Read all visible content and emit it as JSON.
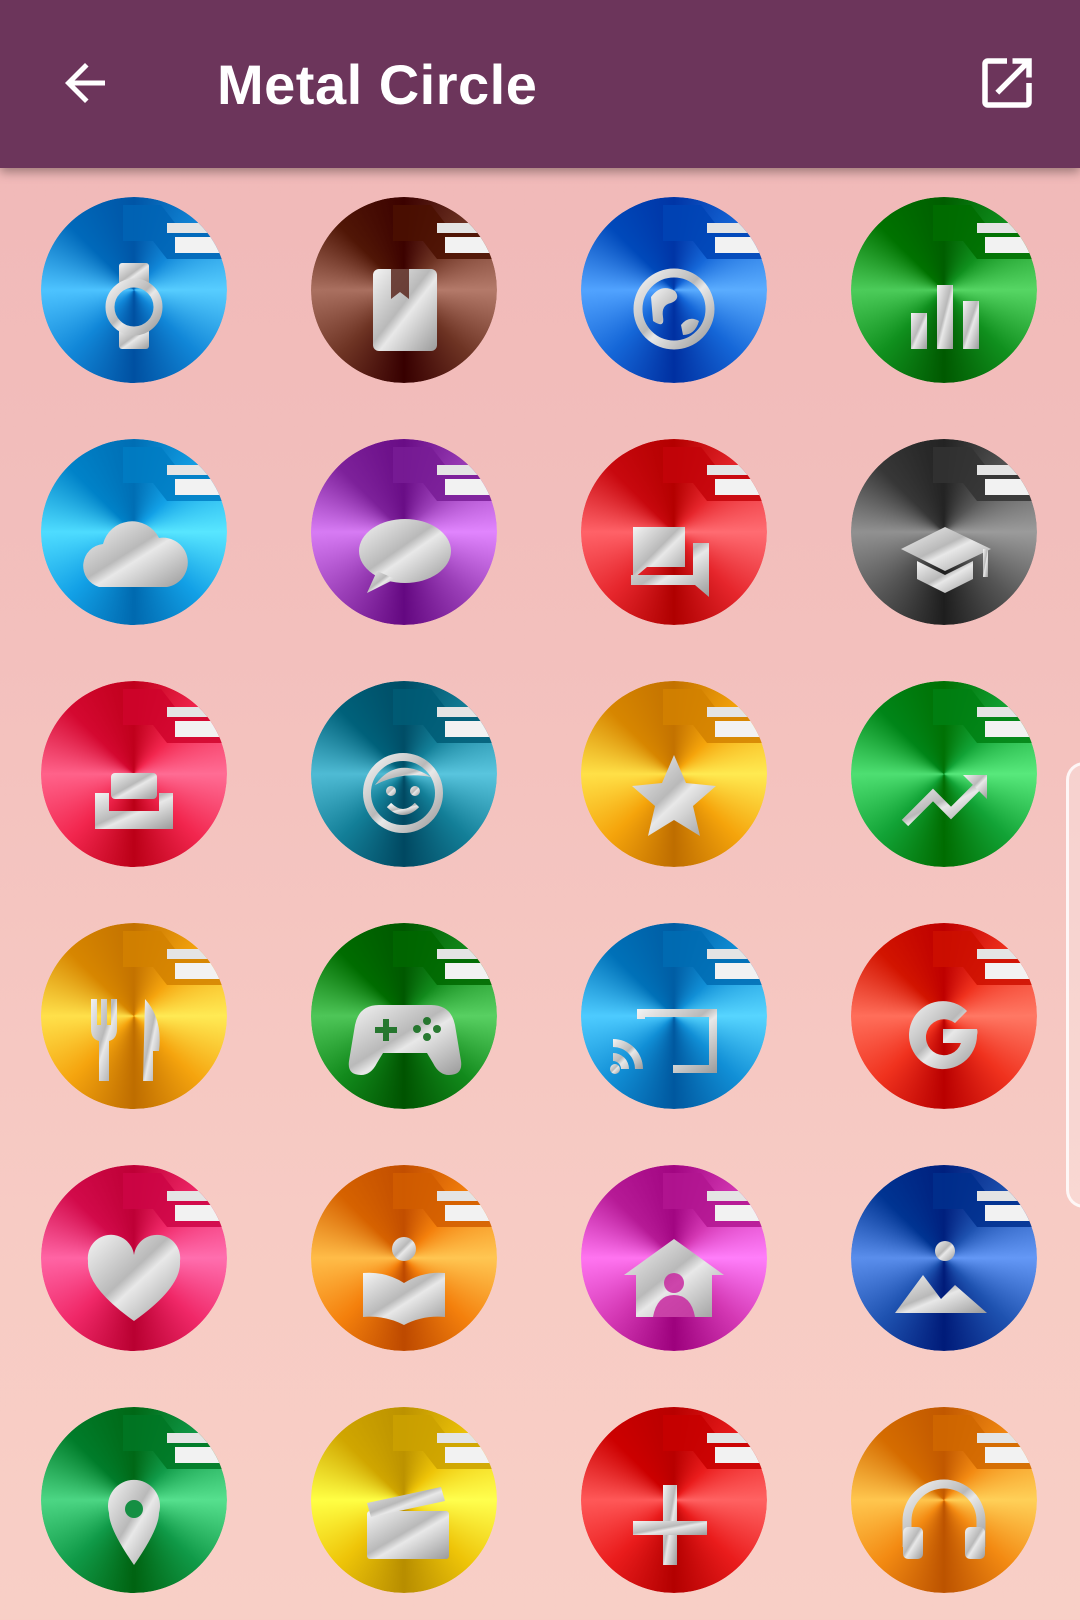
{
  "appbar": {
    "title": "Metal Circle",
    "back_icon": "arrow-left-icon",
    "open_icon": "open-external-icon"
  },
  "icons": [
    {
      "name": "watch",
      "color": "#1187d8"
    },
    {
      "name": "book-bookmark",
      "color": "#6e3424"
    },
    {
      "name": "globe",
      "color": "#1567d8"
    },
    {
      "name": "bar-chart",
      "color": "#10901e"
    },
    {
      "name": "cloud",
      "color": "#12a0e6"
    },
    {
      "name": "chat-bubble",
      "color": "#9b3fb8"
    },
    {
      "name": "messages",
      "color": "#e6262c"
    },
    {
      "name": "graduation-cap",
      "color": "#555555"
    },
    {
      "name": "sofa",
      "color": "#f2264e"
    },
    {
      "name": "kid-face",
      "color": "#137f98"
    },
    {
      "name": "star",
      "color": "#f5a40b"
    },
    {
      "name": "trending-up",
      "color": "#12a336"
    },
    {
      "name": "fork-knife",
      "color": "#f5a40e"
    },
    {
      "name": "gamepad",
      "color": "#128a1c"
    },
    {
      "name": "cast",
      "color": "#118fd6"
    },
    {
      "name": "google-g",
      "color": "#f0321e"
    },
    {
      "name": "heart",
      "color": "#f02868"
    },
    {
      "name": "reader",
      "color": "#f4800c"
    },
    {
      "name": "home",
      "color": "#d438b4"
    },
    {
      "name": "photo",
      "color": "#1e52b0"
    },
    {
      "name": "map-pin",
      "color": "#109a48"
    },
    {
      "name": "clapperboard",
      "color": "#eec408"
    },
    {
      "name": "plus-cross",
      "color": "#ea1c1c"
    },
    {
      "name": "headphones",
      "color": "#f38a12"
    }
  ]
}
